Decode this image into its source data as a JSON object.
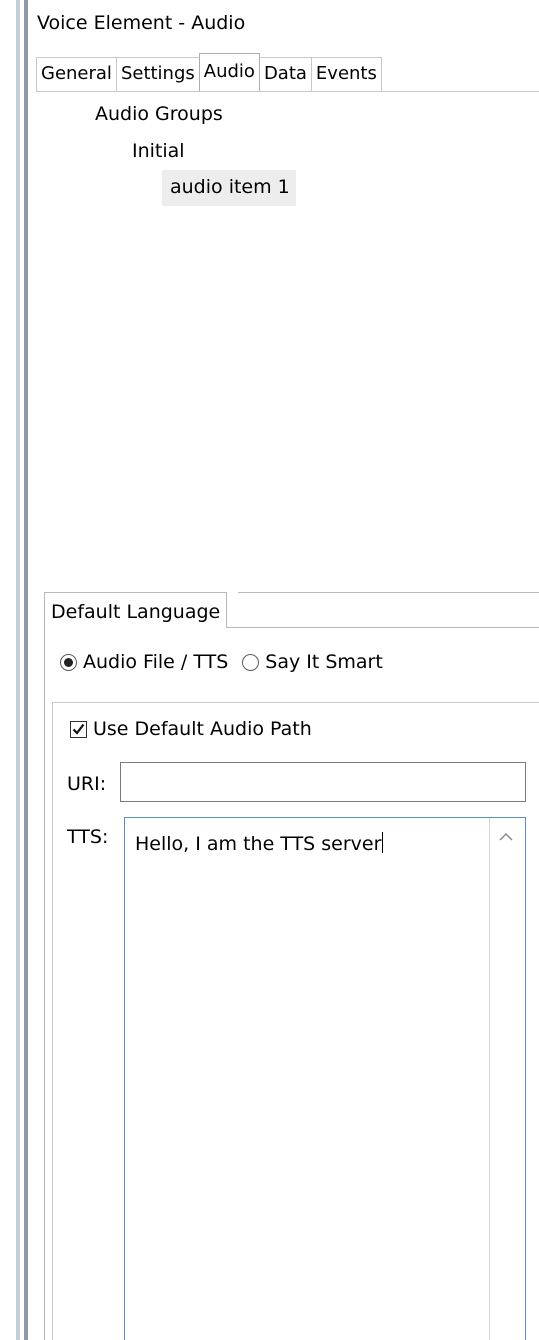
{
  "window": {
    "title": "Voice Element - Audio"
  },
  "tabs": [
    {
      "label": "General",
      "active": false
    },
    {
      "label": "Settings",
      "active": false
    },
    {
      "label": "Audio",
      "active": true
    },
    {
      "label": "Data",
      "active": false
    },
    {
      "label": "Events",
      "active": false
    }
  ],
  "tree": {
    "root": "Audio Groups",
    "group": "Initial",
    "item": "audio item 1"
  },
  "language_tab": {
    "label": "Default Language"
  },
  "source_options": [
    {
      "label": "Audio File / TTS",
      "selected": true
    },
    {
      "label": "Say It Smart",
      "selected": false
    }
  ],
  "use_default_path": {
    "label": "Use Default Audio Path",
    "checked": true
  },
  "uri": {
    "label": "URI:",
    "value": ""
  },
  "tts": {
    "label": "TTS:",
    "value": "Hello, I am the TTS server"
  },
  "icons": {
    "checkbox_check": "check-icon",
    "scroll_up": "chevron-up-icon"
  },
  "colors": {
    "focus_border": "#5b8ec7",
    "frame_bar": "#8f99a8"
  }
}
